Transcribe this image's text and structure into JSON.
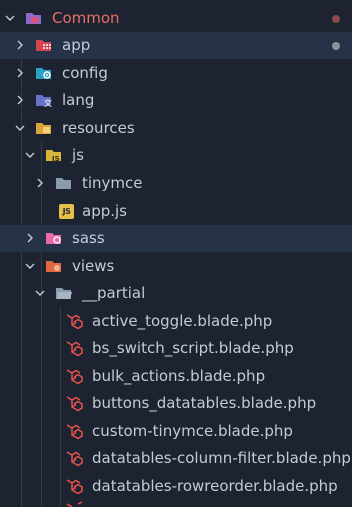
{
  "explorer": {
    "root": {
      "label": "Common"
    },
    "app": {
      "label": "app"
    },
    "config": {
      "label": "config"
    },
    "lang": {
      "label": "lang"
    },
    "resources": {
      "label": "resources"
    },
    "js": {
      "label": "js"
    },
    "tinymce": {
      "label": "tinymce"
    },
    "app_js": {
      "label": "app.js",
      "badge": "JS"
    },
    "sass": {
      "label": "sass"
    },
    "views": {
      "label": "views"
    },
    "partial": {
      "label": "__partial"
    },
    "files": [
      {
        "label": "active_toggle.blade.php"
      },
      {
        "label": "bs_switch_script.blade.php"
      },
      {
        "label": "bulk_actions.blade.php"
      },
      {
        "label": "buttons_datatables.blade.php"
      },
      {
        "label": "custom-tinymce.blade.php"
      },
      {
        "label": "datatables-column-filter.blade.php"
      },
      {
        "label": "datatables-rowreorder.blade.php"
      }
    ]
  },
  "colors": {
    "background": "#1d2330",
    "text": "#c3cbd7",
    "root_text": "#e57068",
    "laravel_icon": "#e8534b",
    "js_badge": "#e5c04b",
    "modified_dot_red": "#8a4a4a",
    "modified_dot_gray": "#8c929c"
  },
  "icons": {
    "chevron_open": "chevron-down-icon",
    "chevron_closed": "chevron-right-icon",
    "laravel_file": "laravel-icon",
    "js_file": "js-file-icon"
  }
}
